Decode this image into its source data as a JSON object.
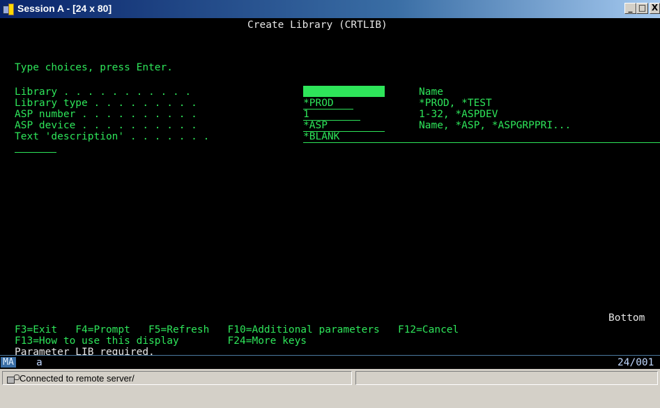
{
  "window": {
    "title": "Session A - [24 x 80]",
    "buttons": {
      "minimize": "_",
      "maximize": "□",
      "close": "X"
    }
  },
  "screen": {
    "heading": "Create Library (CRTLIB)",
    "instruction": "Type choices, press Enter.",
    "fields": [
      {
        "label": "Library . . . . . . . . . . .",
        "value": "",
        "hint": "Name"
      },
      {
        "label": "Library type . . . . . . . . .",
        "value": "*PROD",
        "hint": "*PROD, *TEST"
      },
      {
        "label": "ASP number . . . . . . . . . .",
        "value": "1",
        "hint": "1-32, *ASPDEV"
      },
      {
        "label": "ASP device . . . . . . . . . .",
        "value": "*ASP",
        "hint": "Name, *ASP, *ASPGRPPRI..."
      },
      {
        "label": "Text 'description' . . . . . . .",
        "value": "*BLANK",
        "hint": ""
      }
    ],
    "bottom": "Bottom",
    "function_keys_1": "F3=Exit   F4=Prompt   F5=Refresh   F10=Additional parameters   F12=Cancel",
    "function_keys_2": "F13=How to use this display        F24=More keys",
    "message": "Parameter LIB required."
  },
  "oia": {
    "indicator": "MA",
    "mode": "a",
    "cursor_position": "24/001"
  },
  "statusbar": {
    "text": "Connected to remote server/"
  },
  "colors": {
    "green": "#2ee55a",
    "white": "#e6e6e6",
    "titlebar": "#0a246a"
  }
}
